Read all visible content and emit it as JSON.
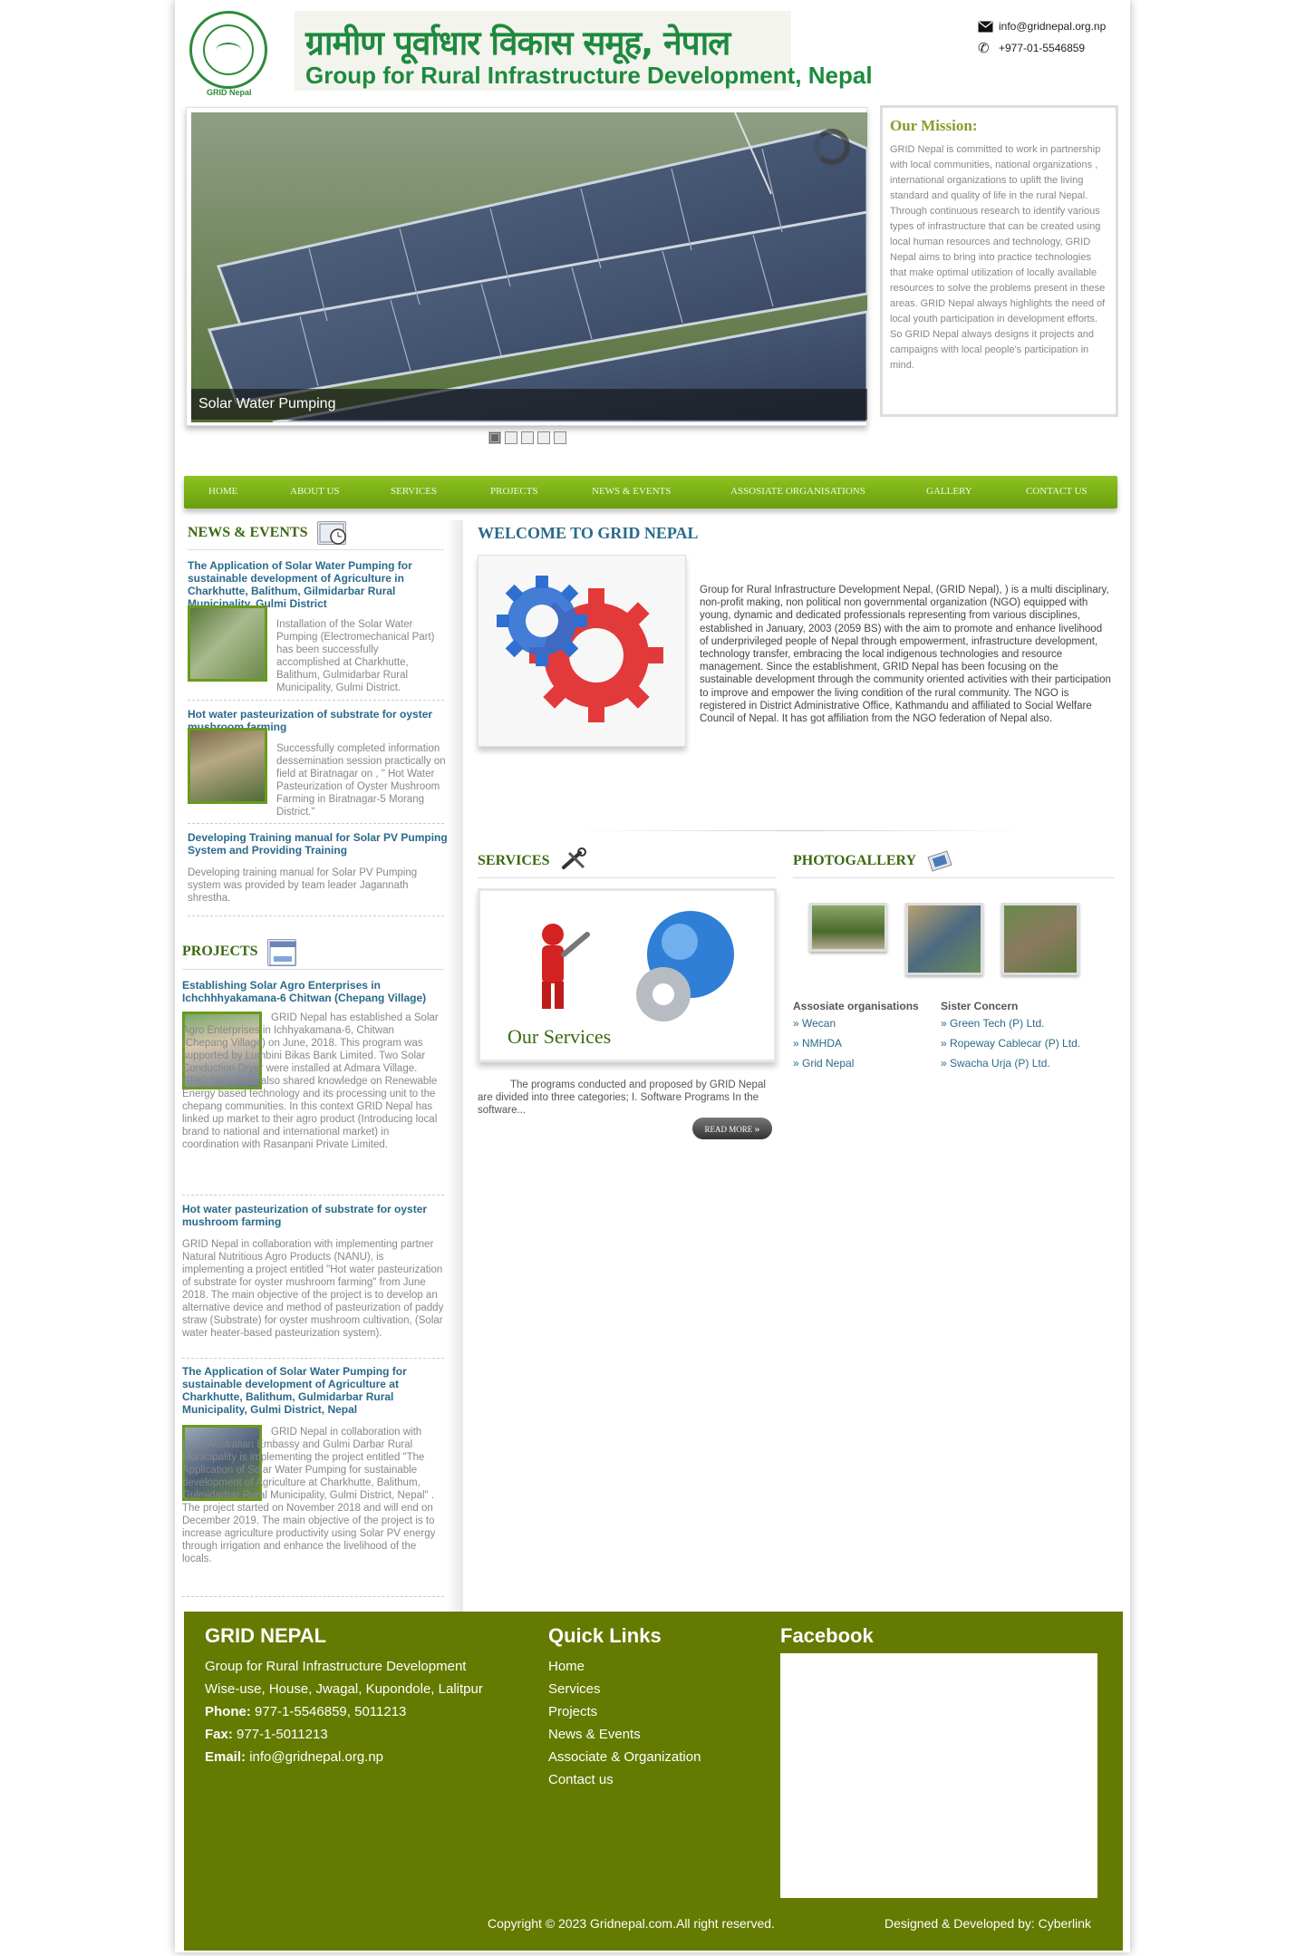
{
  "header": {
    "logo_caption": "GRID Nepal",
    "title_np": "ग्रामीण पूर्वाधार विकास समूह, नेपाल",
    "title_en": "Group for Rural Infrastructure Development, Nepal",
    "email": "info@gridnepal.org.np",
    "phone": "+977-01-5546859",
    "icons": [
      "envelope-icon",
      "phone-icon"
    ]
  },
  "slider": {
    "caption": "Solar Water Pumping",
    "dots": 5,
    "active_dot": 1
  },
  "mission": {
    "title": "Our Mission:",
    "text": "GRID Nepal is committed to work in partnership with local communities, national organizations , international organizations to uplift the living standard and quality of life in the rural Nepal. Through continuous research to identify various types of infrastructure that can be created using local human resources and technology, GRID Nepal aims to bring into practice technologies that make optimal utilization of locally available resources to solve the problems present in these areas. GRID Nepal always highlights the need of local youth participation in development efforts. So GRID Nepal always designs it projects and campaigns with local people's participation in mind."
  },
  "nav": [
    "HOME",
    "ABOUT US",
    "SERVICES",
    "PROJECTS",
    "NEWS & EVENTS",
    "ASSOSIATE ORGANISATIONS",
    "GALLERY",
    "CONTACT US"
  ],
  "news": {
    "title": "NEWS & EVENTS",
    "items": [
      {
        "title": "The Application of Solar Water Pumping for sustainable development of Agriculture in Charkhutte, Balithum, Gilmidarbar Rural Municipality, Gulmi District",
        "text": "Installation of the Solar Water Pumping (Electromechanical Part) has been successfully accomplished at Charkhutte, Balithum, Gulmidarbar Rural Municipality, Gulmi District."
      },
      {
        "title": "Hot water pasteurization of substrate for oyster mushroom farming",
        "text": "Successfully completed information dessemination session practically on field at Biratnagar on , \" Hot Water Pasteurization of Oyster Mushroom Farming in Biratnagar-5 Morang District.\""
      },
      {
        "title": "Developing Training manual for Solar PV Pumping System and Providing Training",
        "text": "Developing training manual for Solar PV Pumping system was provided by team leader Jagannath shrestha."
      }
    ]
  },
  "projects": {
    "title": "PROJECTS",
    "items": [
      {
        "title": "Establishing Solar Agro Enterprises in Ichchhhyakamana-6 Chitwan (Chepang Village)",
        "text": "GRID Nepal has established a Solar Agro Enterprises in Ichhyakamana-6, Chitwan (Chepang Village) on June, 2018. This program was supported by Lumbini Bikas Bank Limited. Two Solar Conduction Dryer were installed at Admara Village. GRID Nepal has also shared knowledge on Renewable Energy based technology and its processing unit to the chepang communities. In this context GRID Nepal has linked up market to their agro product (Introducing local brand to national and international market) in coordination with Rasanpani Private Limited."
      },
      {
        "title": "Hot water pasteurization of substrate for oyster mushroom farming",
        "text": "GRID Nepal in collaboration with implementing partner Natural Nutritious Agro Products (NANU), is implementing a project entitled \"Hot water pasteurization of substrate for oyster mushroom farming\" from June 2018. The main objective of the project is to develop an alternative device and method of pasteurization of paddy straw (Substrate) for oyster mushroom cultivation, (Solar water heater-based pasteurization system)."
      },
      {
        "title": "The Application of Solar Water Pumping for sustainable development of Agriculture at Charkhutte, Balithum, Gulmidarbar Rural Municipality, Gulmi District, Nepal",
        "text": "GRID Nepal in collaboration with DAP, Australian Embassy and Gulmi Darbar Rural Municipality is implementing the project entitled \"The Application of Solar Water Pumping for sustainable development of Agriculture at Charkhutte, Balithum, Gulmidarbar Rural Municipality, Gulmi District, Nepal\" . The project started on November 2018 and will end on December 2019. The main objective of the project is to increase agriculture productivity using Solar PV energy through irrigation and enhance the livelihood of the locals."
      }
    ]
  },
  "welcome": {
    "title": "WELCOME TO GRID NEPAL",
    "text": "Group for Rural Infrastructure Development Nepal, (GRID Nepal), ) is a multi disciplinary, non-profit making, non political non governmental organization (NGO) equipped with young, dynamic and dedicated professionals representing from various disciplines, established in January, 2003 (2059 BS) with the aim to promote and enhance livelihood of underprivileged people of Nepal through empowerment, infrastructure development, technology transfer, embracing the local indigenous technologies and resource management. Since the establishment, GRID Nepal has been focusing on the sustainable development through the community oriented activities with their participation to improve and empower the living condition of the rural community. The NGO is registered in District Administrative Office, Kathmandu and affiliated to Social Welfare Council of Nepal. It has got affiliation from the NGO federation of Nepal also."
  },
  "services": {
    "title": "SERVICES",
    "image_caption": "Our Services",
    "text": "The programs conducted and proposed by GRID Nepal are divided into three categories; I. Software Programs In the software...",
    "read_more": "READ MORE"
  },
  "gallery": {
    "title": "PHOTOGALLERY"
  },
  "organisations": {
    "associate_title": "Assosiate organisations",
    "associate": [
      "» Wecan",
      "» NMHDA",
      "» Grid Nepal"
    ],
    "sister_title": "Sister Concern",
    "sister": [
      "» Green Tech (P) Ltd.",
      "» Ropeway Cablecar (P) Ltd.",
      "» Swacha Urja (P) Ltd."
    ]
  },
  "footer": {
    "org_title": "GRID NEPAL",
    "org_full": "Group for Rural Infrastructure Development",
    "address": "Wise-use, House, Jwagal, Kupondole, Lalitpur",
    "phone_label": "Phone:",
    "phone": "977-1-5546859, 5011213",
    "fax_label": "Fax:",
    "fax": "977-1-5011213",
    "email_label": "Email:",
    "email": "info@gridnepal.org.np",
    "links_title": "Quick Links",
    "links": [
      "Home",
      "Services",
      "Projects",
      "News & Events",
      "Associate & Organization",
      "Contact us"
    ],
    "facebook_title": "Facebook",
    "copyright": "Copyright © 2023 Gridnepal.com.All right reserved.",
    "credit": "Designed & Developed by: Cyberlink"
  },
  "colors": {
    "nav_green": "#7cb518",
    "footer_green": "#647a00",
    "title_blue": "#2a6a8a",
    "section_green": "#3b6a10"
  }
}
